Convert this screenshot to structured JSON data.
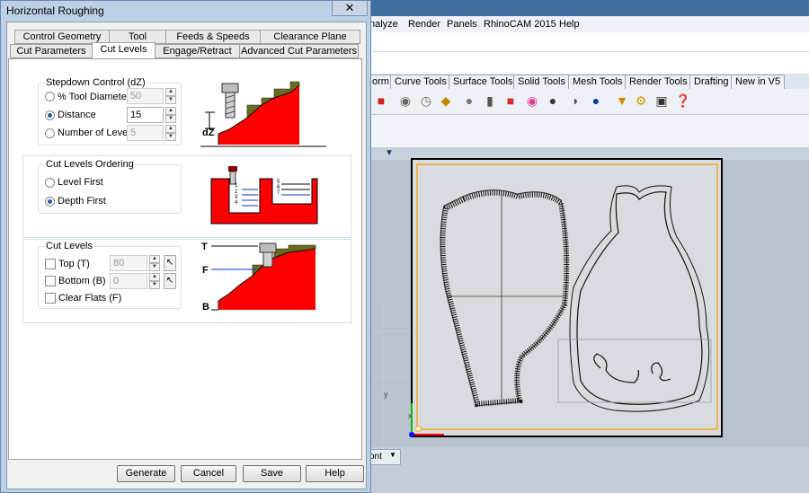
{
  "dialog": {
    "title": "Horizontal Roughing",
    "close_glyph": "✕",
    "tabs_row1": [
      "Control Geometry",
      "Tool",
      "Feeds & Speeds",
      "Clearance Plane"
    ],
    "tabs_row2": [
      "Cut Parameters",
      "Cut Levels",
      "Engage/Retract",
      "Advanced Cut Parameters"
    ],
    "active_tab": "Cut Levels",
    "stepdown": {
      "title": "Stepdown Control (dZ)",
      "options": [
        {
          "label": "% Tool Diameter",
          "value": "50",
          "selected": false
        },
        {
          "label": "Distance",
          "value": "15",
          "selected": true
        },
        {
          "label": "Number of Levels",
          "value": "5",
          "selected": false
        }
      ],
      "illustration_label": "dZ"
    },
    "ordering": {
      "title": "Cut Levels Ordering",
      "options": [
        {
          "label": "Level First",
          "selected": false
        },
        {
          "label": "Depth First",
          "selected": true
        }
      ],
      "illustration_left_numbers": [
        "1",
        "2",
        "3",
        "4"
      ],
      "illustration_right_numbers": [
        "5",
        "6",
        "7"
      ]
    },
    "cut_levels": {
      "title": "Cut Levels",
      "items": [
        {
          "label": "Top (T)",
          "value": "80",
          "checked": false
        },
        {
          "label": "Bottom (B)",
          "value": "0",
          "checked": false
        },
        {
          "label": "Clear Flats (F)",
          "checked": false
        }
      ],
      "illustration_labels": [
        "T",
        "F",
        "B"
      ]
    },
    "buttons": [
      "Generate",
      "Cancel",
      "Save",
      "Help"
    ]
  },
  "app": {
    "menu": [
      "nalyze",
      "Render",
      "Panels",
      "RhinoCAM 2015",
      "Help"
    ],
    "toolbar_tabs": [
      "orm",
      "Curve Tools",
      "Surface Tools",
      "Solid Tools",
      "Mesh Tools",
      "Render Tools",
      "Drafting",
      "New in V5"
    ],
    "viewport_bottom_label": "ont",
    "axis_labels": {
      "y": "y",
      "x": "x"
    }
  },
  "colors": {
    "stock_red": "#ff0000",
    "olive_step": "#6b6b1e",
    "boundary_orange": "#f5a623",
    "axis_green": "#00c000",
    "axis_red": "#ff0000",
    "axis_blue": "#0000ff"
  }
}
